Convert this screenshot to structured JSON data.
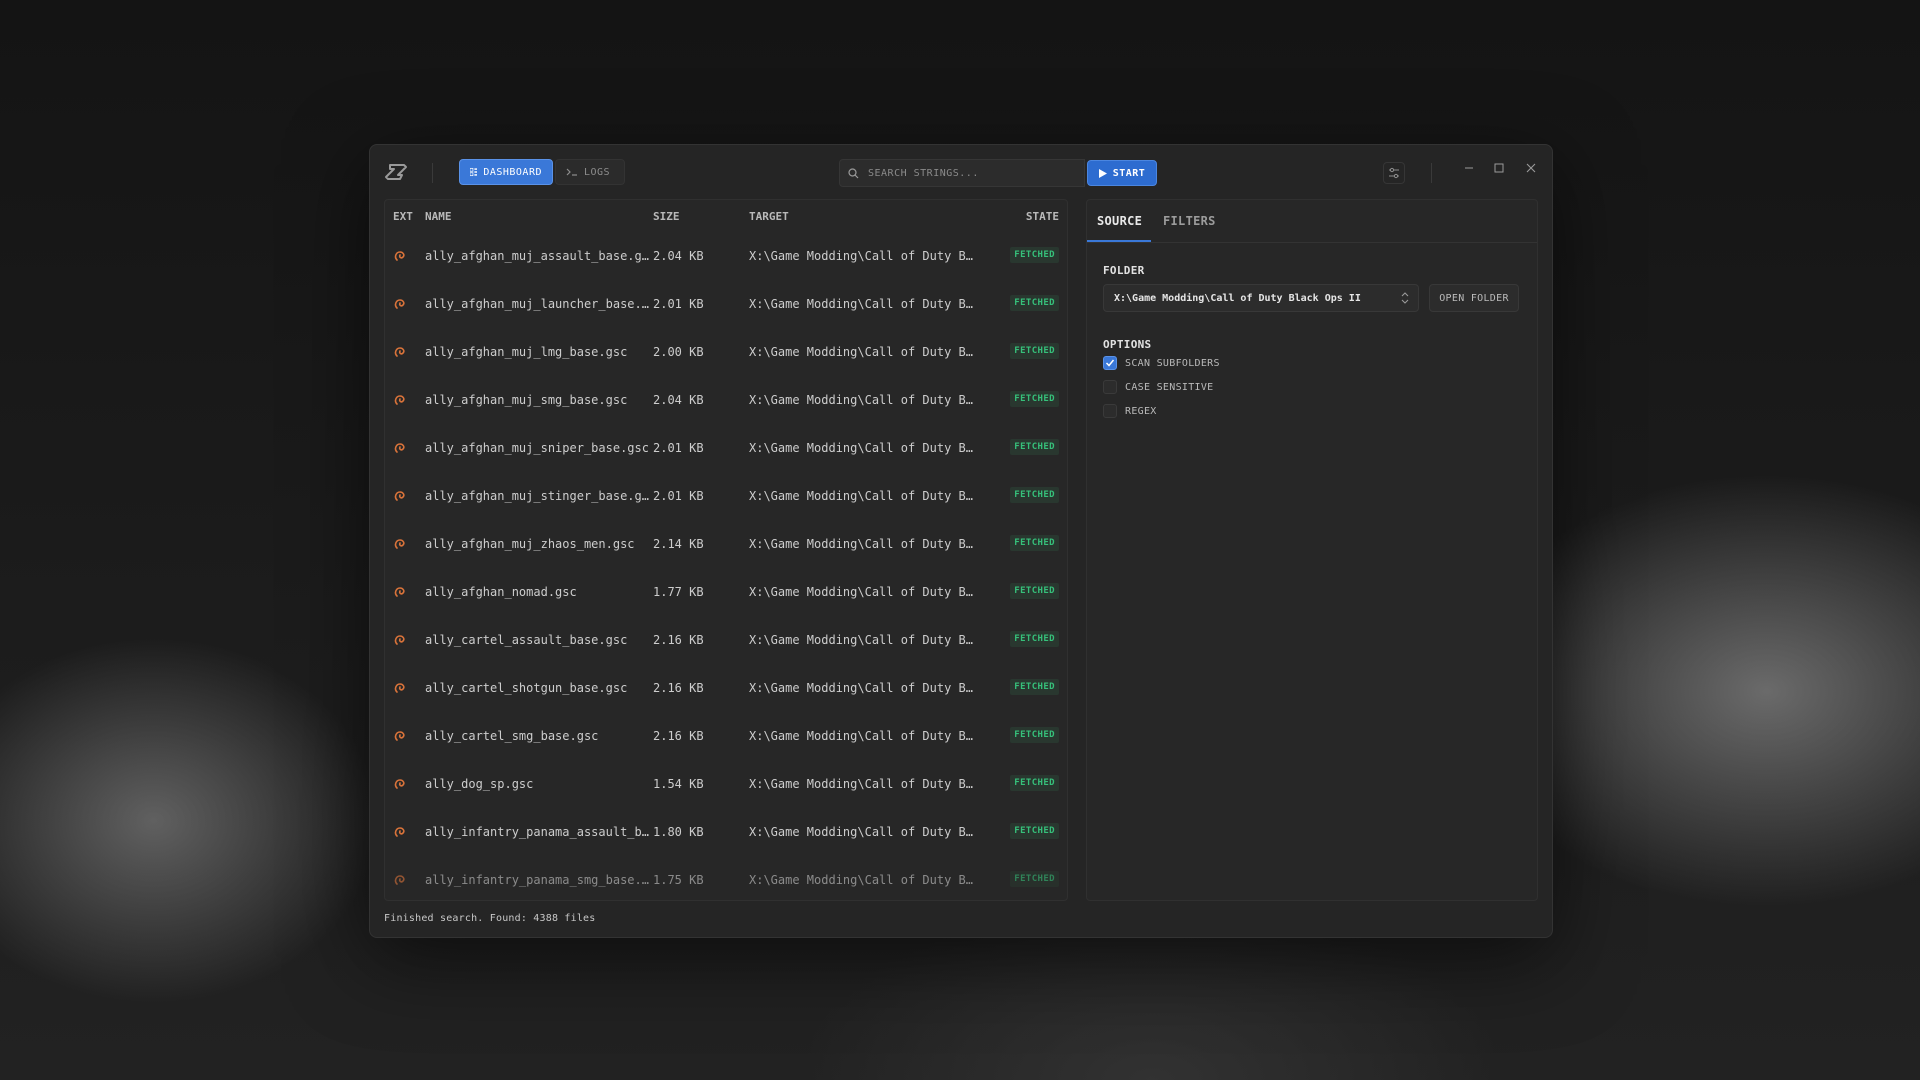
{
  "header": {
    "nav": [
      {
        "label": "DASHBOARD",
        "icon": "dashboard-icon",
        "active": true
      },
      {
        "label": "LOGS",
        "icon": "terminal-icon",
        "active": false
      }
    ],
    "search_placeholder": "SEARCH STRINGS...",
    "start_label": "START"
  },
  "table": {
    "columns": {
      "ext": "EXT",
      "name": "NAME",
      "size": "SIZE",
      "target": "TARGET",
      "state": "STATE"
    },
    "rows": [
      {
        "name": "ally_afghan_muj_assault_base.gsc",
        "size": "2.04 KB",
        "target": "X:\\Game Modding\\Call of Duty Black Ops II",
        "state": "FETCHED"
      },
      {
        "name": "ally_afghan_muj_launcher_base.gsc",
        "size": "2.01 KB",
        "target": "X:\\Game Modding\\Call of Duty Black Ops II",
        "state": "FETCHED"
      },
      {
        "name": "ally_afghan_muj_lmg_base.gsc",
        "size": "2.00 KB",
        "target": "X:\\Game Modding\\Call of Duty Black Ops II",
        "state": "FETCHED"
      },
      {
        "name": "ally_afghan_muj_smg_base.gsc",
        "size": "2.04 KB",
        "target": "X:\\Game Modding\\Call of Duty Black Ops II",
        "state": "FETCHED"
      },
      {
        "name": "ally_afghan_muj_sniper_base.gsc",
        "size": "2.01 KB",
        "target": "X:\\Game Modding\\Call of Duty Black Ops II",
        "state": "FETCHED"
      },
      {
        "name": "ally_afghan_muj_stinger_base.gsc",
        "size": "2.01 KB",
        "target": "X:\\Game Modding\\Call of Duty Black Ops II",
        "state": "FETCHED"
      },
      {
        "name": "ally_afghan_muj_zhaos_men.gsc",
        "size": "2.14 KB",
        "target": "X:\\Game Modding\\Call of Duty Black Ops II",
        "state": "FETCHED"
      },
      {
        "name": "ally_afghan_nomad.gsc",
        "size": "1.77 KB",
        "target": "X:\\Game Modding\\Call of Duty Black Ops II",
        "state": "FETCHED"
      },
      {
        "name": "ally_cartel_assault_base.gsc",
        "size": "2.16 KB",
        "target": "X:\\Game Modding\\Call of Duty Black Ops II",
        "state": "FETCHED"
      },
      {
        "name": "ally_cartel_shotgun_base.gsc",
        "size": "2.16 KB",
        "target": "X:\\Game Modding\\Call of Duty Black Ops II",
        "state": "FETCHED"
      },
      {
        "name": "ally_cartel_smg_base.gsc",
        "size": "2.16 KB",
        "target": "X:\\Game Modding\\Call of Duty Black Ops II",
        "state": "FETCHED"
      },
      {
        "name": "ally_dog_sp.gsc",
        "size": "1.54 KB",
        "target": "X:\\Game Modding\\Call of Duty Black Ops II",
        "state": "FETCHED"
      },
      {
        "name": "ally_infantry_panama_assault_base.gsc",
        "size": "1.80 KB",
        "target": "X:\\Game Modding\\Call of Duty Black Ops II",
        "state": "FETCHED"
      },
      {
        "name": "ally_infantry_panama_smg_base.gsc",
        "size": "1.75 KB",
        "target": "X:\\Game Modding\\Call of Duty Black Ops II",
        "state": "FETCHED"
      }
    ]
  },
  "side": {
    "tabs": [
      "SOURCE",
      "FILTERS"
    ],
    "folder_label": "FOLDER",
    "folder_value": "X:\\Game Modding\\Call of Duty Black Ops II",
    "open_folder_label": "OPEN FOLDER",
    "options_label": "OPTIONS",
    "options": [
      {
        "label": "SCAN SUBFOLDERS",
        "checked": true
      },
      {
        "label": "CASE SENSITIVE",
        "checked": false
      },
      {
        "label": "REGEX",
        "checked": false
      }
    ]
  },
  "status": "Finished search. Found: 4388 files",
  "colors": {
    "accent": "#3a78d8",
    "fetched": "#36c07a",
    "file_icon": "#d9733a"
  }
}
